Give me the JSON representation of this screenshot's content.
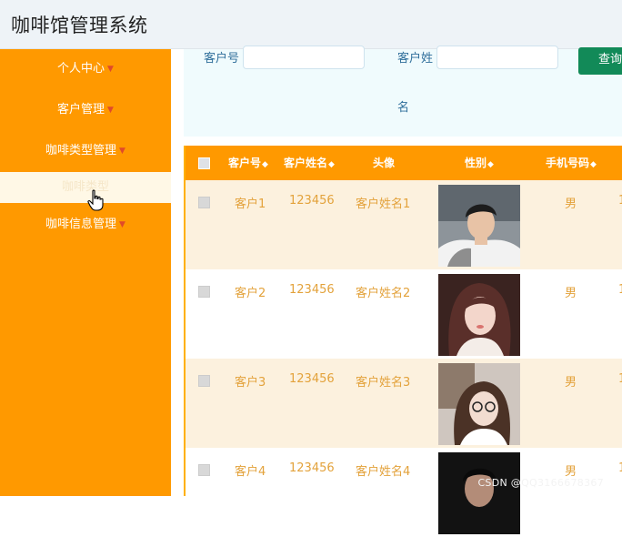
{
  "app": {
    "title": "咖啡馆管理系统"
  },
  "sidebar": {
    "items": [
      {
        "label": "个人中心",
        "caret": true
      },
      {
        "label": "客户管理",
        "caret": true
      },
      {
        "label": "咖啡类型管理",
        "caret": true
      },
      {
        "label": "咖啡类型",
        "caret": false,
        "active": true
      },
      {
        "label": "咖啡信息管理",
        "caret": true
      }
    ]
  },
  "search": {
    "field1_label": "客户号",
    "field1_value": "",
    "field2_label_line1": "客户姓",
    "field2_label_line2": "名",
    "field2_value": "",
    "button_label": "查询"
  },
  "table": {
    "columns": [
      "客户号",
      "客户姓名",
      "头像",
      "性别",
      "手机号码"
    ],
    "rows": [
      {
        "id": "客户1",
        "password": "123456",
        "name": "客户姓名1",
        "avatar": "photo-man",
        "gender": "男",
        "phone": "1"
      },
      {
        "id": "客户2",
        "password": "123456",
        "name": "客户姓名2",
        "avatar": "photo-woman",
        "gender": "男",
        "phone": "1"
      },
      {
        "id": "客户3",
        "password": "123456",
        "name": "客户姓名3",
        "avatar": "photo-woman-glasses",
        "gender": "男",
        "phone": "1"
      },
      {
        "id": "客户4",
        "password": "123456",
        "name": "客户姓名4",
        "avatar": "photo-dark",
        "gender": "男",
        "phone": "1"
      }
    ]
  },
  "watermark": "CSDN @QQ3166678367",
  "colors": {
    "sidebar": "#ff9900",
    "header_row": "#ff9900",
    "row_highlight": "#fcf1de",
    "query_button": "#128a58",
    "cell_text": "#e3a23b"
  }
}
